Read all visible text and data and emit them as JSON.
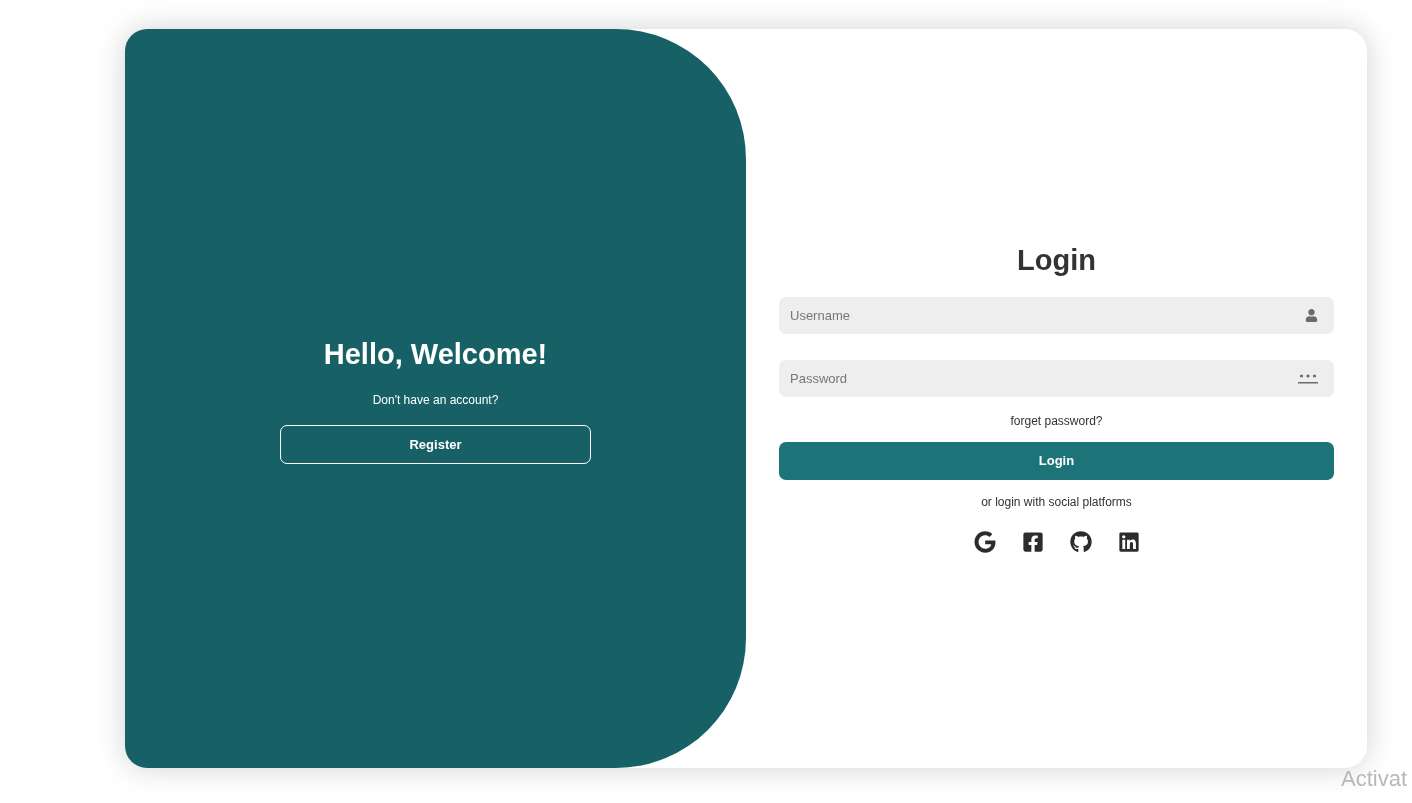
{
  "welcome_panel": {
    "title": "Hello, Welcome!",
    "subtitle": "Don't have an account?",
    "button": "Register"
  },
  "login_form": {
    "title": "Login",
    "fields": [
      {
        "kind": "username",
        "placeholder": "Username"
      },
      {
        "kind": "password",
        "placeholder": "Password"
      }
    ],
    "forgot_link": "forget password?",
    "submit": "Login",
    "social_caption": "or login with social platforms",
    "social": [
      {
        "kind": "google"
      },
      {
        "kind": "facebook"
      },
      {
        "kind": "github"
      },
      {
        "kind": "linkedin"
      }
    ]
  },
  "system_overlay": {
    "text": "Activat"
  }
}
